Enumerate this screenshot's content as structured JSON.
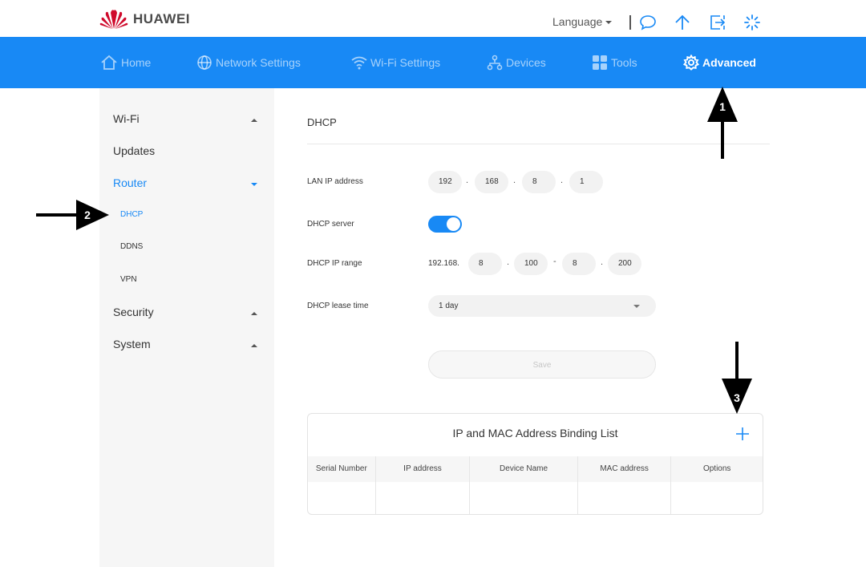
{
  "header": {
    "logo_text": "HUAWEI",
    "language_label": "Language",
    "icons": [
      "chat-icon",
      "update-arrow-icon",
      "logout-icon",
      "loading-icon"
    ]
  },
  "nav": {
    "items": [
      {
        "label": "Home",
        "icon": "home-icon"
      },
      {
        "label": "Network Settings",
        "icon": "globe-icon"
      },
      {
        "label": "Wi-Fi Settings",
        "icon": "wifi-icon"
      },
      {
        "label": "Devices",
        "icon": "devices-icon"
      },
      {
        "label": "Tools",
        "icon": "tools-icon"
      },
      {
        "label": "Advanced",
        "icon": "gear-icon",
        "active": true
      }
    ]
  },
  "sidebar": {
    "groups": [
      {
        "label": "Wi-Fi",
        "expanded": false
      },
      {
        "label": "Updates"
      },
      {
        "label": "Router",
        "expanded": true,
        "active": true,
        "items": [
          "DHCP",
          "DDNS",
          "VPN"
        ],
        "active_item": "DHCP"
      },
      {
        "label": "Security",
        "expanded": false
      },
      {
        "label": "System",
        "expanded": false
      }
    ]
  },
  "content": {
    "title": "DHCP",
    "lan_ip_label": "LAN IP address",
    "lan_ip": [
      "192",
      "168",
      "8",
      "1"
    ],
    "dhcp_server_label": "DHCP server",
    "dhcp_server_enabled": true,
    "dhcp_range_label": "DHCP IP range",
    "dhcp_range_prefix": "192.168.",
    "dhcp_range_start": [
      "8",
      "100"
    ],
    "dhcp_range_end": [
      "8",
      "200"
    ],
    "lease_label": "DHCP lease time",
    "lease_value": "1 day",
    "save_label": "Save",
    "separator_dot": ".",
    "separator_dash": "-"
  },
  "binding_list": {
    "title": "IP and MAC Address Binding List",
    "columns": [
      "Serial Number",
      "IP address",
      "Device Name",
      "MAC address",
      "Options"
    ]
  },
  "annotations": [
    "1",
    "2",
    "3"
  ],
  "colors": {
    "accent": "#1889f5",
    "logo_red": "#cf0a2c"
  }
}
